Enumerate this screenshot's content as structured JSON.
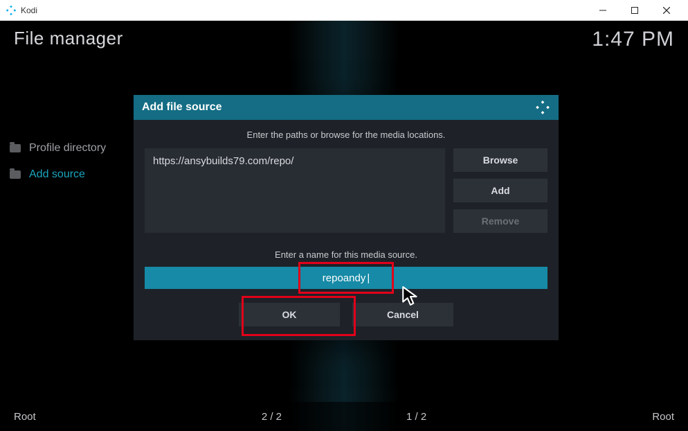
{
  "window": {
    "title": "Kodi"
  },
  "header": {
    "page_title": "File manager",
    "clock": "1:47 PM"
  },
  "sidebar": {
    "items": [
      {
        "label": "Profile directory",
        "active": false
      },
      {
        "label": "Add source",
        "active": true
      }
    ]
  },
  "footer": {
    "left": "Root",
    "center_left": "2 / 2",
    "center_right": "1 / 2",
    "right": "Root"
  },
  "dialog": {
    "title": "Add file source",
    "path_hint": "Enter the paths or browse for the media locations.",
    "path_value": "https://ansybuilds79.com/repo/",
    "browse_label": "Browse",
    "add_label": "Add",
    "remove_label": "Remove",
    "name_hint": "Enter a name for this media source.",
    "name_value": "repoandy",
    "ok_label": "OK",
    "cancel_label": "Cancel"
  }
}
